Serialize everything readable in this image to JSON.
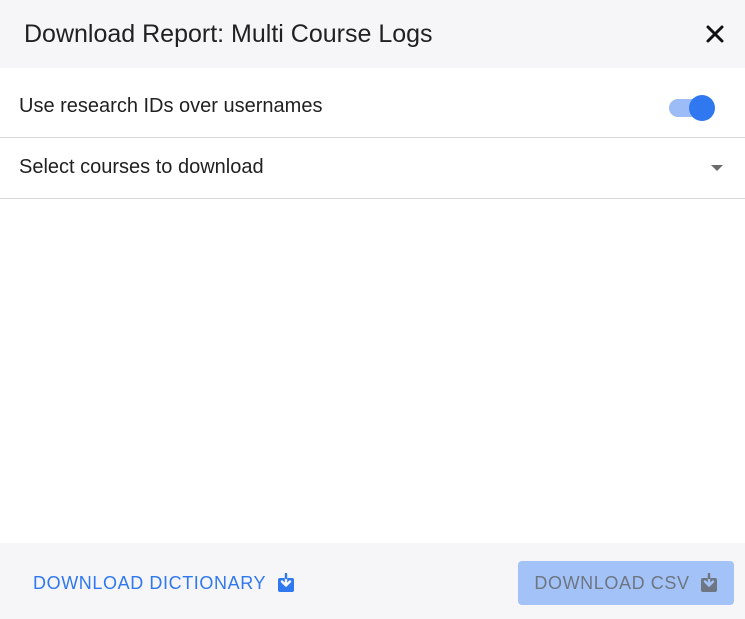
{
  "dialog": {
    "title": "Download Report: Multi Course Logs"
  },
  "options": {
    "research_ids_label": "Use research IDs over usernames",
    "research_ids_enabled": true,
    "courses_placeholder": "Select courses to download"
  },
  "footer": {
    "dictionary_label": "DOWNLOAD DICTIONARY",
    "csv_label": "DOWNLOAD CSV",
    "csv_disabled": true
  },
  "colors": {
    "accent": "#2f78f0",
    "accent_light": "#9bbcf7",
    "disabled_button": "#a3c2f7",
    "header_bg": "#f6f6f8"
  },
  "icons": {
    "close": "close-icon",
    "dropdown": "chevron-down-icon",
    "download": "download-icon"
  }
}
